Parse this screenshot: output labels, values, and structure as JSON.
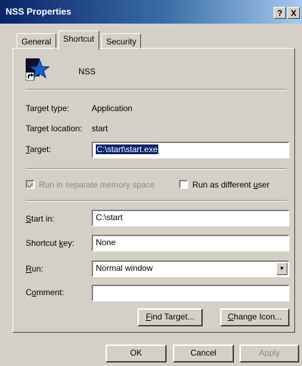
{
  "window": {
    "title": "NSS Properties",
    "help_button": "?",
    "close_button": "X"
  },
  "tabs": [
    {
      "label": "General"
    },
    {
      "label": "Shortcut"
    },
    {
      "label": "Security"
    }
  ],
  "app": {
    "name": "NSS",
    "icon": "shortcut-star-icon"
  },
  "info": {
    "target_type_label": "Target type:",
    "target_type_value": "Application",
    "target_location_label": "Target location:",
    "target_location_value": "start"
  },
  "target": {
    "label_first": "T",
    "label_rest": "arget:",
    "value": "C:\\start\\start.exe"
  },
  "options": {
    "separate_memory": {
      "label": "Run in separate memory space",
      "checked": true,
      "enabled": false
    },
    "run_as_different_user": {
      "label_pre": "Run as different ",
      "label_u": "u",
      "label_post": "ser",
      "checked": false
    }
  },
  "start_in": {
    "label_first": "S",
    "label_rest": "tart in:",
    "value": "C:\\start"
  },
  "shortcut_key": {
    "label_pre": "Shortcut ",
    "label_u": "k",
    "label_post": "ey:",
    "value": "None"
  },
  "run": {
    "label_first": "R",
    "label_rest": "un:",
    "value": "Normal window"
  },
  "comment": {
    "label_pre": "C",
    "label_u": "o",
    "label_post": "mment:",
    "value": ""
  },
  "panel_buttons": {
    "find_target_first": "F",
    "find_target_rest": "ind Target...",
    "change_icon_first": "C",
    "change_icon_rest": "hange Icon..."
  },
  "footer": {
    "ok": "OK",
    "cancel": "Cancel",
    "apply": "Apply"
  },
  "colors": {
    "title_gradient_start": "#0a246a",
    "title_gradient_end": "#a6caf0",
    "face": "#d4d0c8",
    "selection": "#0a246a"
  }
}
